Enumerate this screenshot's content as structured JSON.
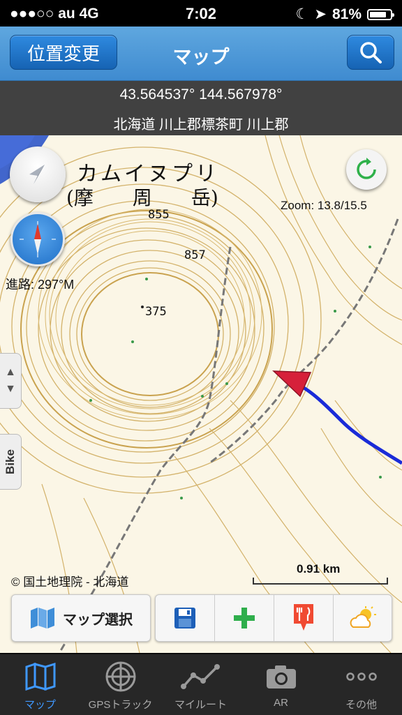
{
  "status_bar": {
    "carrier": "●●●○○ au 4G",
    "time": "7:02",
    "battery": "81%",
    "battery_level": 0.81
  },
  "navbar": {
    "left_button": "位置変更",
    "title": "マップ",
    "right_icon": "search-icon"
  },
  "location": {
    "coords": "43.564537° 144.567978°",
    "address": "北海道 川上郡標茶町 川上郡"
  },
  "map": {
    "mountain_name": "カムイヌプリ",
    "mountain_kanji": "(摩　　周　　岳)",
    "elev_855": "855",
    "elev_857": "857",
    "elev_375": "375",
    "zoom": "Zoom: 13.8/15.5",
    "heading": "進路: 297°M",
    "copyright": "© 国土地理院 - 北海道",
    "scale": "0.91 km",
    "mode_tab": "Bike",
    "colors": {
      "contour": "#d3b26a",
      "track": "#1a2bd8",
      "arrow": "#d6203a",
      "water": "#2e56c9"
    }
  },
  "toolbar": {
    "map_select": "マップ選択",
    "icons": [
      "save-icon",
      "add-icon",
      "restaurant-icon",
      "weather-icon"
    ]
  },
  "tabs": [
    {
      "label": "マップ",
      "icon": "map-icon",
      "active": true
    },
    {
      "label": "GPSトラック",
      "icon": "radar-icon",
      "active": false
    },
    {
      "label": "マイルート",
      "icon": "route-icon",
      "active": false
    },
    {
      "label": "AR",
      "icon": "camera-icon",
      "active": false
    },
    {
      "label": "その他",
      "icon": "more-icon",
      "active": false
    }
  ]
}
